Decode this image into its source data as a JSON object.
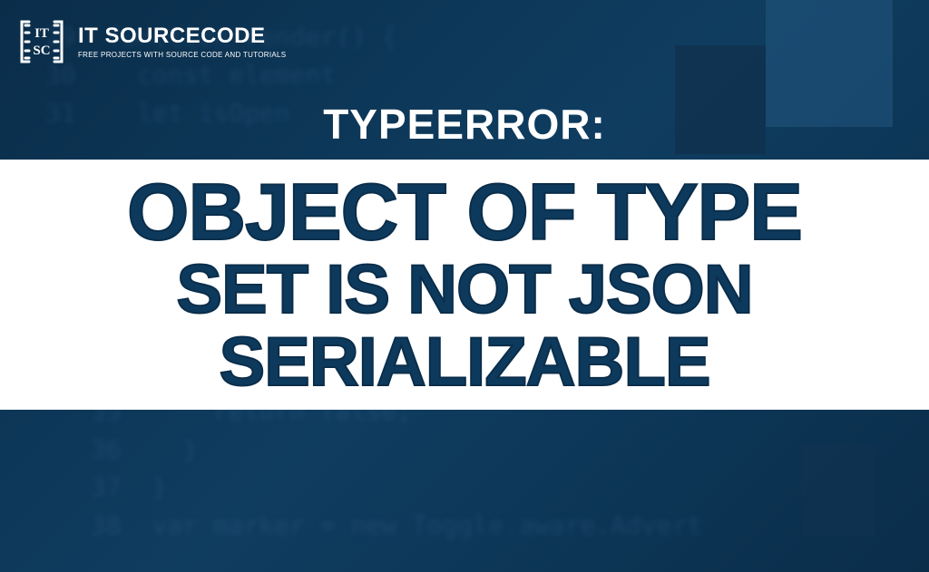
{
  "logo": {
    "brand_name": "IT SOURCECODE",
    "tagline": "FREE PROJECTS WITH SOURCE CODE AND TUTORIALS",
    "monogram": "IT SC"
  },
  "heading": "TYPEERROR:",
  "banner": {
    "line1": "OBJECT OF TYPE",
    "line2": "SET IS NOT JSON SERIALIZABLE"
  }
}
